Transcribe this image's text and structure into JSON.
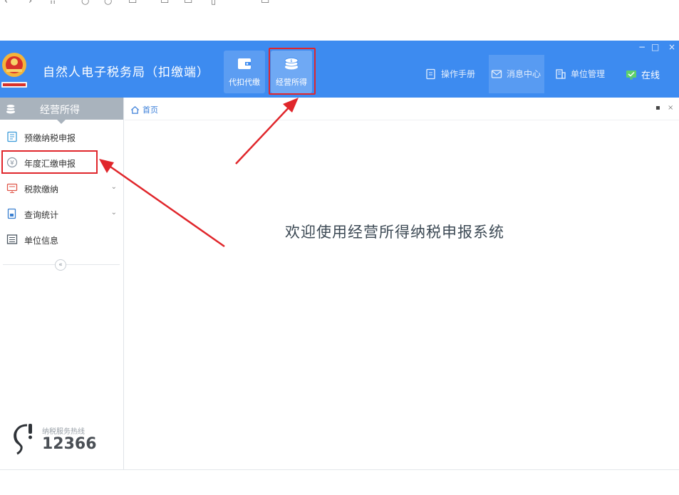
{
  "app": {
    "title": "自然人电子税务局（扣缴端）",
    "brand_color": "#3d8bf0",
    "highlight_color": "#e0262b"
  },
  "modules": [
    {
      "label": "代扣代缴",
      "icon": "wallet-icon"
    },
    {
      "label": "经营所得",
      "icon": "coins-icon"
    }
  ],
  "header_nav": {
    "manual": "操作手册",
    "messages": "消息中心",
    "unit_mgmt": "单位管理",
    "online": "在线"
  },
  "window_controls": {
    "minimize": "−",
    "maximize": "□",
    "close": "×"
  },
  "sidebar": {
    "title": "经营所得",
    "items": [
      {
        "label": "预缴纳税申报",
        "icon": "form-icon",
        "expandable": false
      },
      {
        "label": "年度汇缴申报",
        "icon": "yen-icon",
        "expandable": false,
        "highlighted": true
      },
      {
        "label": "税款缴纳",
        "icon": "payment-icon",
        "expandable": true
      },
      {
        "label": "查询统计",
        "icon": "report-icon",
        "expandable": true
      },
      {
        "label": "单位信息",
        "icon": "list-icon",
        "expandable": false
      }
    ],
    "collapse": "«",
    "hotline_label": "纳税服务热线",
    "hotline_number": "12366"
  },
  "tabs": {
    "home": "首页",
    "ctl_restore": "▪",
    "ctl_close": "×"
  },
  "main": {
    "welcome": "欢迎使用经营所得纳税申报系统"
  }
}
